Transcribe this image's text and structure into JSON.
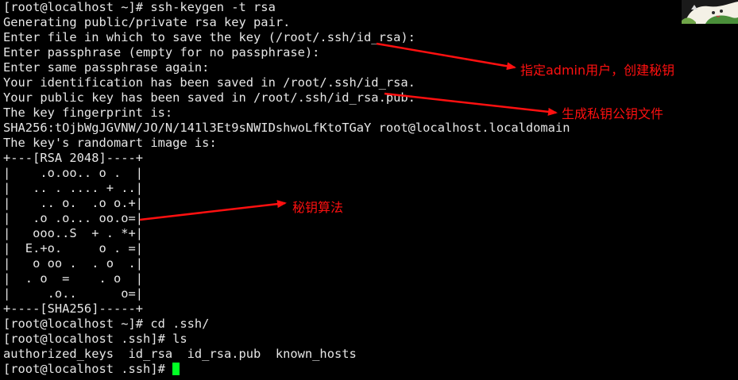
{
  "terminal": {
    "lines": [
      "[root@localhost ~]# ssh-keygen -t rsa",
      "Generating public/private rsa key pair.",
      "Enter file in which to save the key (/root/.ssh/id_rsa):",
      "Enter passphrase (empty for no passphrase):",
      "Enter same passphrase again:",
      "Your identification has been saved in /root/.ssh/id_rsa.",
      "Your public key has been saved in /root/.ssh/id_rsa.pub.",
      "The key fingerprint is:",
      "SHA256:tOjbWgJGVNW/JO/N/141l3Et9sNWIDshwoLfKtoTGaY root@localhost.localdomain",
      "The key's randomart image is:",
      "+---[RSA 2048]----+",
      "|    .o.oo.. o .  |",
      "|   .. . .... + ..|",
      "|    .. o.  .o o.+|",
      "|   .o .o... oo.o=|",
      "|   ooo..S  + . *+|",
      "|  E.+o.     o . =|",
      "|   o oo .  . o  .|",
      "|  . o  =    . o  |",
      "|     .o..      o=|",
      "+----[SHA256]-----+",
      "[root@localhost ~]# cd .ssh/",
      "[root@localhost .ssh]# ls",
      "authorized_keys  id_rsa  id_rsa.pub  known_hosts"
    ],
    "prompt_line": "[root@localhost .ssh]# ",
    "cursor_color": "#00ff24",
    "background_color": "#000000",
    "text_color": "#e6e6e6"
  },
  "annotations": {
    "color": "#ff1010",
    "items": [
      "指定admin用户，创建秘钥",
      "生成私钥公钥文件",
      "秘钥算法"
    ]
  }
}
